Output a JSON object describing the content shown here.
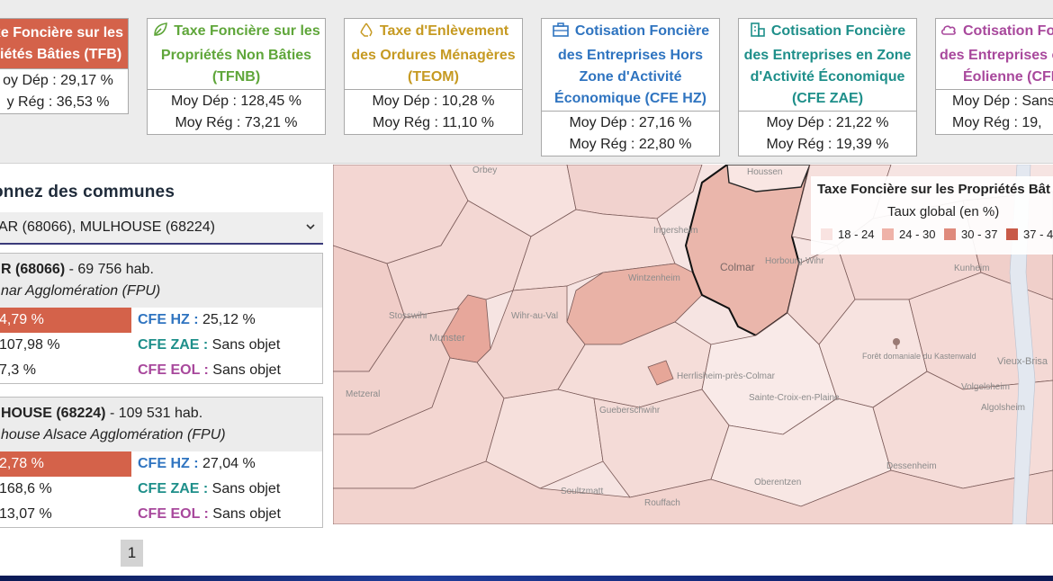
{
  "cards": {
    "tfb": {
      "title_line1": "xe Foncière sur les",
      "title_line2": "riétés Bâties (TFB)",
      "dep": "oy Dép : 29,17 %",
      "reg": "y Rég : 36,53 %"
    },
    "tfnb": {
      "icon": "leaf-icon",
      "title_line1": "Taxe Foncière sur les",
      "title_line2": "Propriétés Non Bâties",
      "title_line3": "(TFNB)",
      "dep": "Moy Dép : 128,45 %",
      "reg": "Moy Rég : 73,21 %"
    },
    "teom": {
      "icon": "recycle-icon",
      "title_line1": "Taxe d'Enlèvement",
      "title_line2": "des Ordures Ménagères",
      "title_line3": "(TEOM)",
      "dep": "Moy Dép : 10,28 %",
      "reg": "Moy Rég : 11,10 %"
    },
    "cfehz": {
      "icon": "briefcase-icon",
      "title_line1": "Cotisation Foncière",
      "title_line2": "des Entreprises Hors",
      "title_line3": "Zone d'Activité",
      "title_line4": "Économique (CFE HZ)",
      "dep": "Moy Dép : 27,16 %",
      "reg": "Moy Rég : 22,80 %"
    },
    "cfezae": {
      "icon": "building-icon",
      "title_line1": "Cotisation Foncière",
      "title_line2": "des Entreprises en Zone",
      "title_line3": "d'Activité Économique",
      "title_line4": "(CFE ZAE)",
      "dep": "Moy Dép : 21,22 %",
      "reg": "Moy Rég : 19,39 %"
    },
    "cfeeol": {
      "icon": "cloud-icon",
      "title_line1": "Cotisation Fo",
      "title_line2": "des Entreprises c",
      "title_line3": "Éolienne (CFE",
      "dep": "Moy Dép : Sans",
      "reg": "Moy Rég : 19,"
    }
  },
  "selector": {
    "title": "onnez des communes",
    "value": "AR (68066), MULHOUSE (68224)"
  },
  "communes": [
    {
      "name": "R (68066)",
      "population": " - 69 756 hab.",
      "epci": "nar Agglomération (FPU)",
      "tfb": "4,79 %",
      "tfb_share": 0.95,
      "tfnb": "107,98 %",
      "teom": "7,3 %",
      "cfe_hz_label": "CFE HZ :",
      "cfe_hz": " 25,12 %",
      "cfe_zae_label": "CFE ZAE :",
      "cfe_zae": " Sans objet",
      "cfe_eol_label": "CFE EOL :",
      "cfe_eol": " Sans objet"
    },
    {
      "name": "HOUSE (68224)",
      "population": " - 109 531 hab.",
      "epci": "house Alsace Agglomération (FPU)",
      "tfb": "2,78 %",
      "tfb_share": 0.95,
      "tfnb": "168,6 %",
      "teom": "13,07 %",
      "cfe_hz_label": "CFE HZ :",
      "cfe_hz": " 27,04 %",
      "cfe_zae_label": "CFE ZAE :",
      "cfe_zae": " Sans objet",
      "cfe_eol_label": "CFE EOL :",
      "cfe_eol": " Sans objet"
    }
  ],
  "pagination": {
    "page": "1"
  },
  "map": {
    "place_labels": [
      "Orbey",
      "Houssen",
      "Ingersheim",
      "Colmar",
      "Horbourg-Wihr",
      "Kunheim",
      "Wintzenheim",
      "Wihr-au-Val",
      "Stosswihr",
      "Munster",
      "Forêt domaniale du Kastenwald",
      "Herrlisheim-près-Colmar",
      "Sainte-Croix-en-Plaine",
      "Volgelsheim",
      "Algolsheim",
      "Vieux-Brisa",
      "Metzeral",
      "Gueberschwihr",
      "Dessenheim",
      "Oberentzen",
      "Soultzmatt",
      "Rouffach"
    ],
    "legend_title": "Taxe Foncière sur les Propriétés Bât",
    "legend_subtitle": "Taux global (en %)",
    "legend_items": [
      {
        "label": "18 - 24",
        "color": "#f9e3e1"
      },
      {
        "label": "24 - 30",
        "color": "#efb2a8"
      },
      {
        "label": "30 - 37",
        "color": "#df8a7c"
      },
      {
        "label": "37 - 4",
        "color": "#c85a48"
      }
    ]
  },
  "colors": {
    "tfb": "#d4624a",
    "tfnb": "#5fa63a",
    "teom": "#c69a22",
    "cfe_hz": "#2f74c0",
    "cfe_zae": "#1e8f8a",
    "cfe_eol": "#a8489c"
  }
}
